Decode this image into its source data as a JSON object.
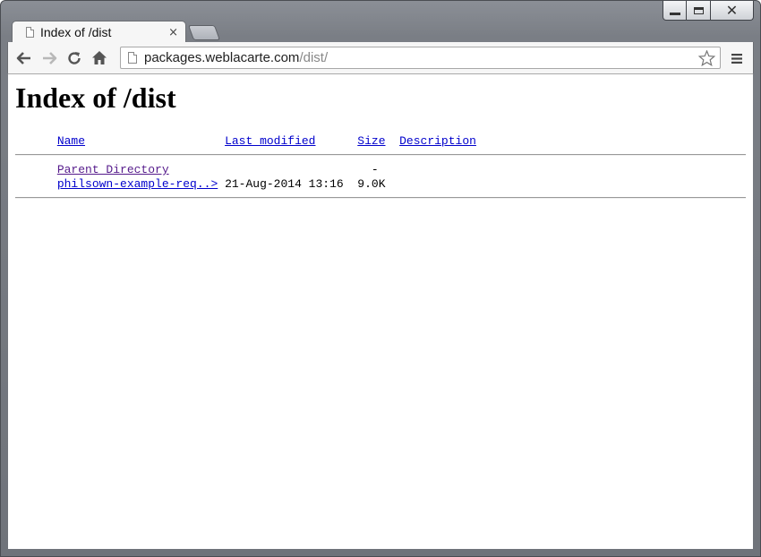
{
  "browser": {
    "tab_title": "Index of /dist",
    "tab_close": "×",
    "url_host": "packages.weblacarte.com",
    "url_path": "/dist/"
  },
  "page": {
    "heading": "Index of /dist",
    "columns": {
      "name": "Name",
      "last_modified": "Last modified",
      "size": "Size",
      "description": "Description"
    },
    "rows": [
      {
        "name": "Parent Directory",
        "modified": "",
        "size": "-",
        "description": ""
      },
      {
        "name": "philsown-example-req..>",
        "modified": "21-Aug-2014 13:16",
        "size": "9.0K",
        "description": ""
      }
    ]
  },
  "icons": {
    "back": "back-arrow-icon",
    "forward": "forward-arrow-icon",
    "reload": "reload-icon",
    "home": "home-icon",
    "bookmark": "star-icon",
    "menu": "hamburger-menu-icon"
  }
}
